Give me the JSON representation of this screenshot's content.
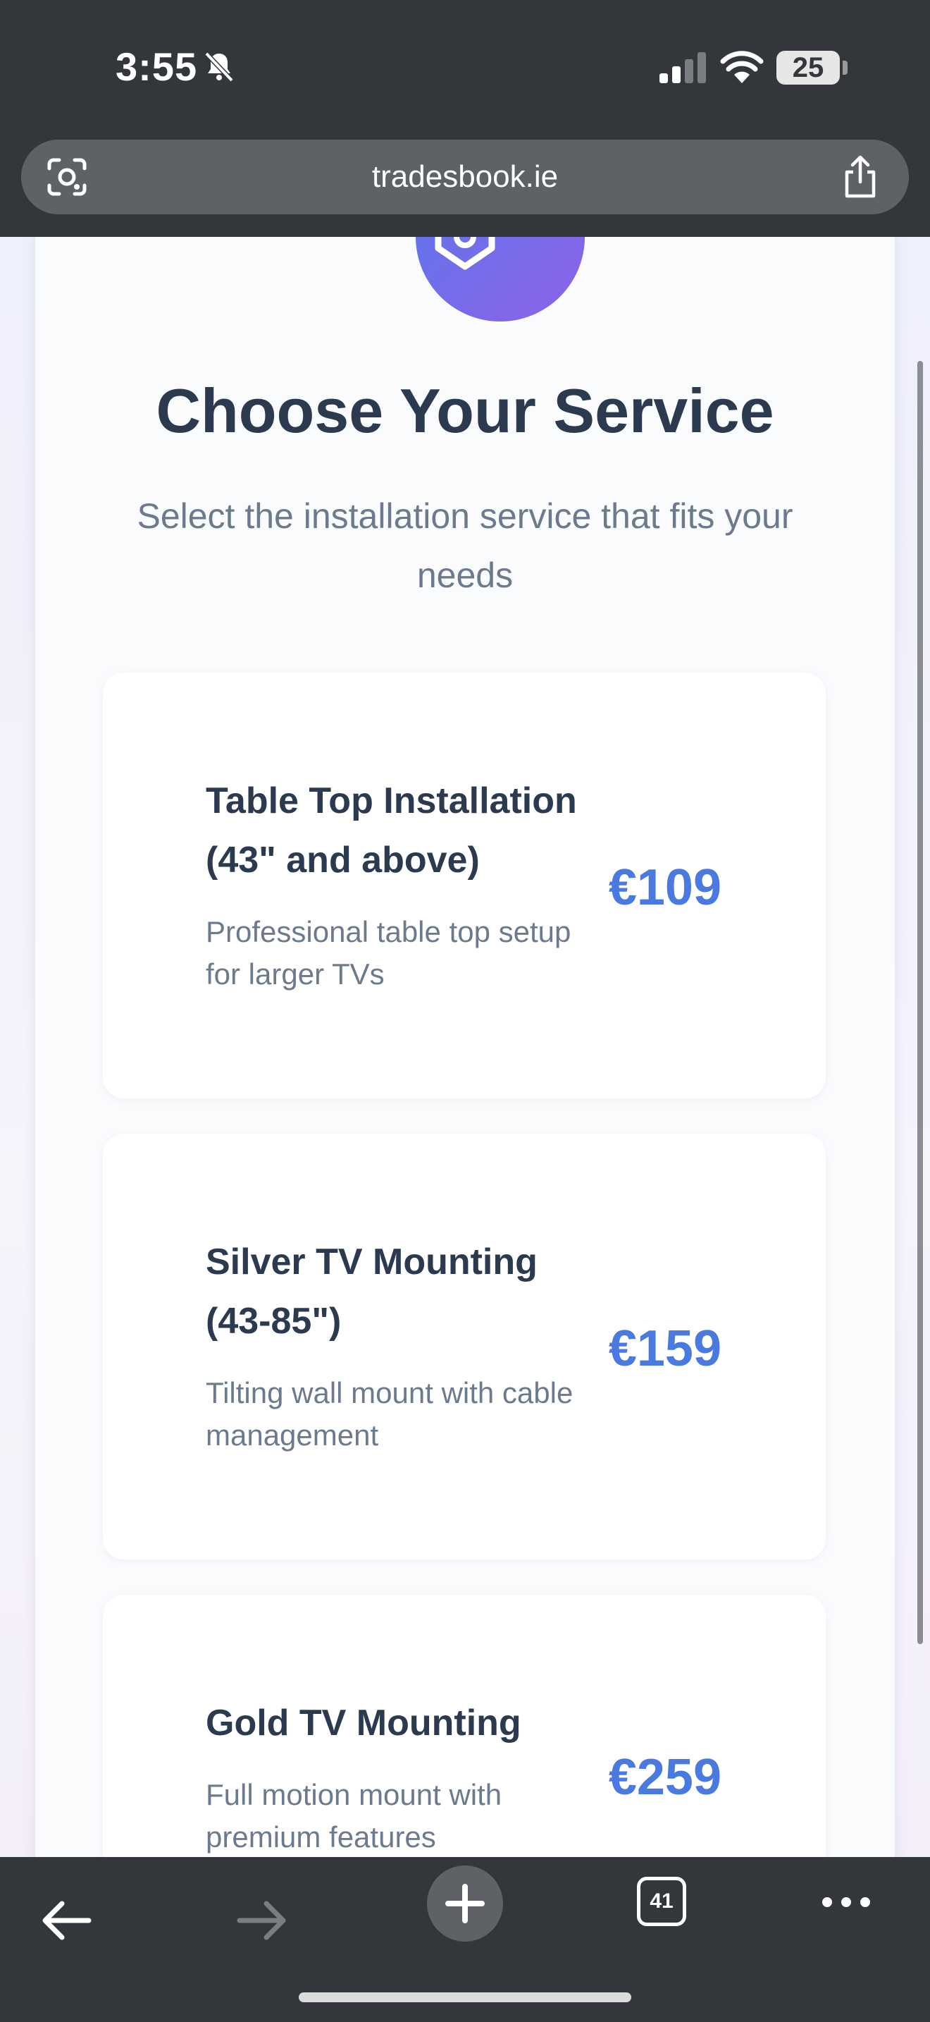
{
  "status_bar": {
    "time": "3:55",
    "battery": "25"
  },
  "url_bar": {
    "url": "tradesbook.ie"
  },
  "page": {
    "title": "Choose Your Service",
    "subtitle": "Select the installation service that fits your needs",
    "services": [
      {
        "title": "Table Top Installation (43\" and above)",
        "description": "Professional table top setup for larger TVs",
        "price": "€109"
      },
      {
        "title": "Silver TV Mounting (43-85\")",
        "description": "Tilting wall mount with cable management",
        "price": "€159"
      },
      {
        "title": "Gold TV Mounting",
        "description": "Full motion mount with premium features",
        "price": "€259"
      }
    ]
  },
  "toolbar": {
    "tab_count": "41"
  },
  "colors": {
    "browser_chrome": "#33373b",
    "accent_price": "#4a7ae0",
    "heading": "#2c3a4f",
    "muted_text": "#6c7a8e"
  },
  "icons": [
    "bell-slash-icon",
    "cellular-signal-icon",
    "wifi-icon",
    "battery-icon",
    "visual-lookup-icon",
    "share-icon",
    "shield-logo-icon",
    "back-arrow-icon",
    "forward-arrow-icon",
    "plus-icon",
    "tabs-icon",
    "more-icon"
  ]
}
